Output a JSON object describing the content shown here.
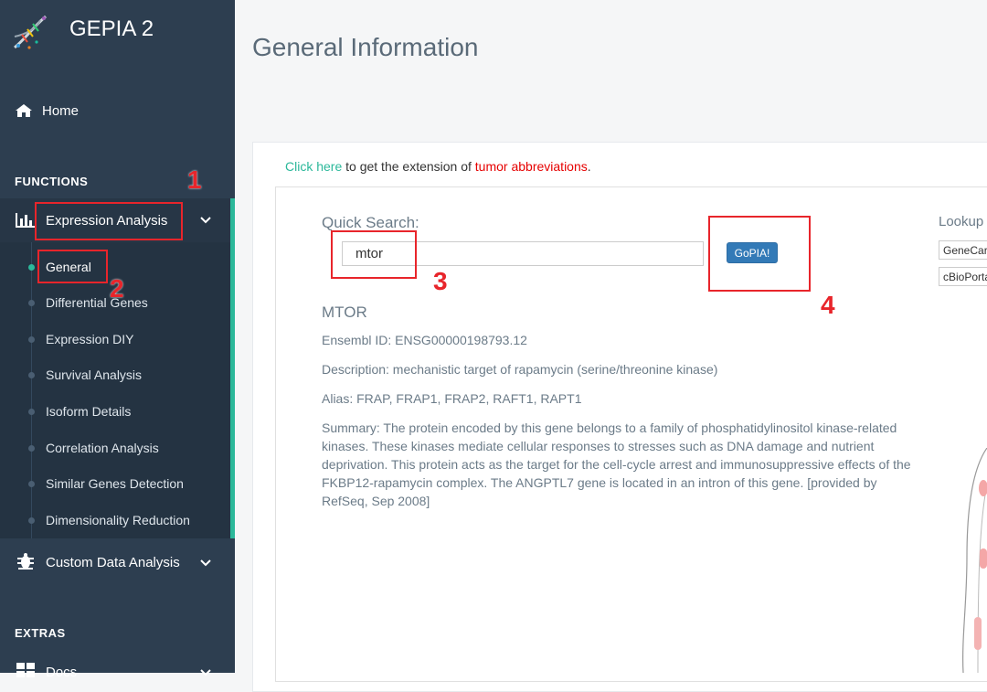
{
  "app": {
    "brand": "GEPIA 2"
  },
  "page": {
    "title": "General Information"
  },
  "sidebar": {
    "home": "Home",
    "functions_title": "FUNCTIONS",
    "expression_analysis": "Expression Analysis",
    "submenu": [
      "General",
      "Differential Genes",
      "Expression DIY",
      "Survival Analysis",
      "Isoform Details",
      "Correlation Analysis",
      "Similar Genes Detection",
      "Dimensionality Reduction"
    ],
    "custom_data": "Custom Data Analysis",
    "extras_title": "EXTRAS",
    "docs": "Docs"
  },
  "extension": {
    "click_here": "Click here",
    "middle": " to get the extension of ",
    "tumor_abbrev": "tumor abbreviations",
    "period": "."
  },
  "search": {
    "label": "Quick Search:",
    "value": "mtor",
    "button": "GoPIA!"
  },
  "gene": {
    "name": "MTOR",
    "ensembl": "Ensembl ID: ENSG00000198793.12",
    "description": "Description: mechanistic target of rapamycin (serine/threonine kinase)",
    "alias": "Alias: FRAP, FRAP1, FRAP2, RAFT1, RAPT1",
    "summary": "Summary: The protein encoded by this gene belongs to a family of phosphatidylinositol kinase-related kinases. These kinases mediate cellular responses to stresses such as DNA damage and nutrient deprivation. This protein acts as the target for the cell-cycle arrest and immunosuppressive effects of the FKBP12-rapamycin complex. The ANGPTL7 gene is located in an intron of this gene. [provided by RefSeq, Sep 2008]"
  },
  "lookup": {
    "label": "Lookup",
    "buttons": [
      "GeneCards",
      "cBioPortal"
    ]
  },
  "annotations": [
    "1",
    "2",
    "3",
    "4"
  ],
  "colors": {
    "sidebar": "#2d3e50",
    "accent": "#2bb89a",
    "annotation": "#e8252b",
    "button": "#337ab7"
  }
}
